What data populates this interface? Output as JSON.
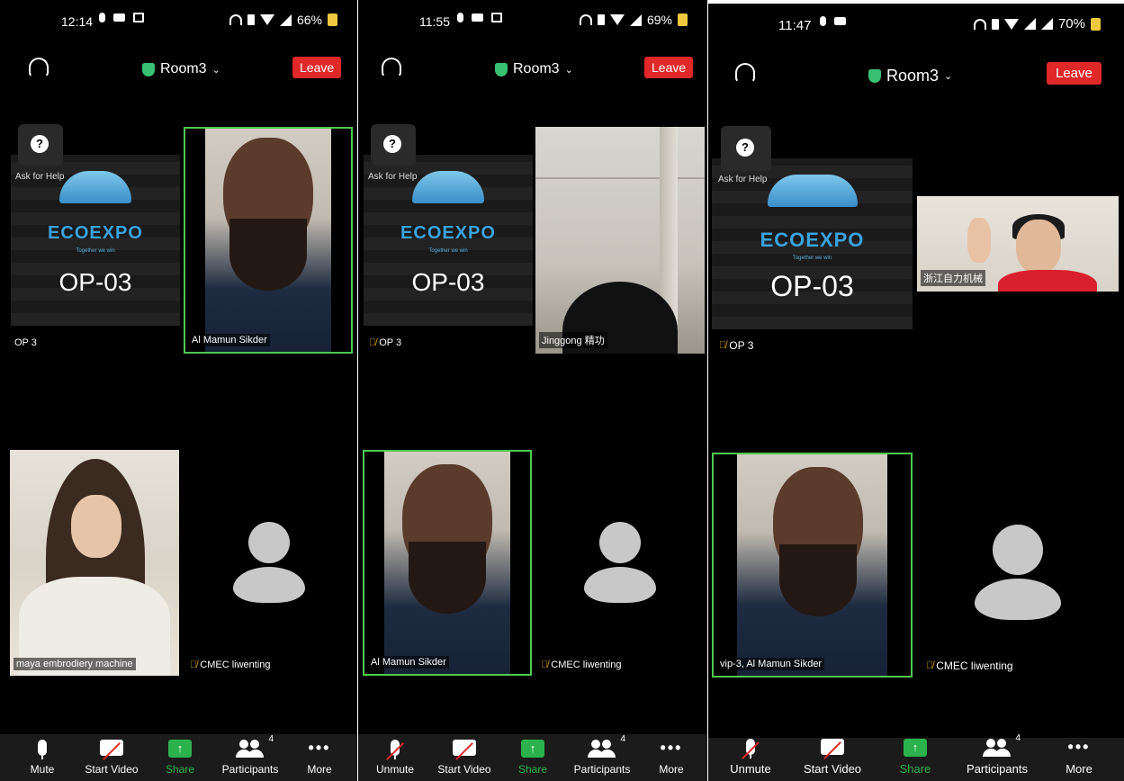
{
  "phones": [
    {
      "status": {
        "time": "12:14",
        "battery": "66%"
      },
      "room": "Room3",
      "leave": "Leave",
      "help_label": "Ask for Help",
      "expo": {
        "logo": "ECOEXPO",
        "tagline": "Together we win",
        "code": "OP-03"
      },
      "tiles": {
        "expo_name": "OP 3",
        "top_right_name": "Al Mamun Sikder",
        "bottom_left_name": "maya embrodiery machine",
        "bottom_right_name": "CMEC liwenting"
      },
      "toolbar": {
        "mic": "Mute",
        "video": "Start Video",
        "share": "Share",
        "participants": "Participants",
        "participants_count": "4",
        "more": "More"
      }
    },
    {
      "status": {
        "time": "11:55",
        "battery": "69%"
      },
      "room": "Room3",
      "leave": "Leave",
      "help_label": "Ask for Help",
      "expo": {
        "logo": "ECOEXPO",
        "tagline": "Together we win",
        "code": "OP-03"
      },
      "tiles": {
        "expo_name": "OP 3",
        "top_right_name": "Jinggong 精功",
        "bottom_left_name": "Al Mamun Sikder",
        "bottom_right_name": "CMEC liwenting"
      },
      "toolbar": {
        "mic": "Unmute",
        "video": "Start Video",
        "share": "Share",
        "participants": "Participants",
        "participants_count": "4",
        "more": "More"
      }
    },
    {
      "status": {
        "time": "11:47",
        "battery": "70%"
      },
      "room": "Room3",
      "leave": "Leave",
      "help_label": "Ask for Help",
      "expo": {
        "logo": "ECOEXPO",
        "tagline": "Together we win",
        "code": "OP-03"
      },
      "tiles": {
        "expo_name": "OP 3",
        "top_right_name": "浙江自力机械",
        "bottom_left_name": "vip-3, Al Mamun Sikder",
        "bottom_right_name": "CMEC liwenting"
      },
      "toolbar": {
        "mic": "Unmute",
        "video": "Start Video",
        "share": "Share",
        "participants": "Participants",
        "participants_count": "4",
        "more": "More"
      }
    }
  ],
  "colors": {
    "leave": "#e02828",
    "active_speaker": "#4ec94e",
    "share": "#2bb24c",
    "secure": "#38c172"
  }
}
